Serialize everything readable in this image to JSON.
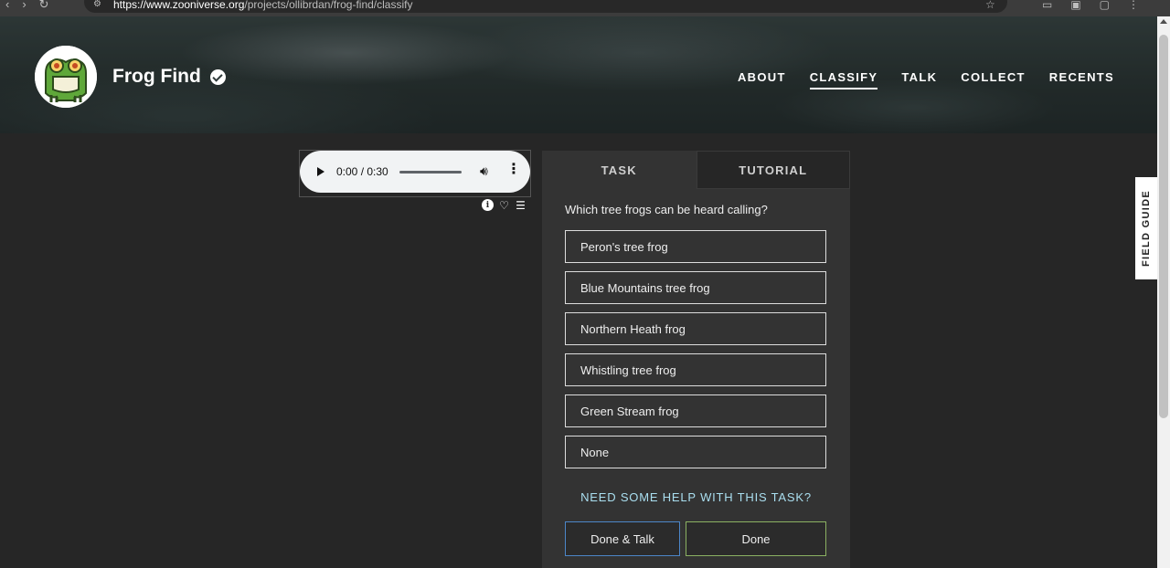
{
  "browser": {
    "url_host": "https://www.zooniverse.org",
    "url_path": "/projects/ollibrdan/frog-find/classify"
  },
  "header": {
    "title": "Frog Find",
    "nav": [
      {
        "label": "ABOUT",
        "active": false
      },
      {
        "label": "CLASSIFY",
        "active": true
      },
      {
        "label": "TALK",
        "active": false
      },
      {
        "label": "COLLECT",
        "active": false
      },
      {
        "label": "RECENTS",
        "active": false
      }
    ]
  },
  "audio": {
    "time": "0:00 / 0:30"
  },
  "task_panel": {
    "tabs": [
      {
        "label": "TASK",
        "active": true
      },
      {
        "label": "TUTORIAL",
        "active": false
      }
    ],
    "question": "Which tree frogs can be heard calling?",
    "answers": [
      "Peron's tree frog",
      "Blue Mountains tree frog",
      "Northern Heath frog",
      "Whistling tree frog",
      "Green Stream frog",
      "None"
    ],
    "help_label": "NEED SOME HELP WITH THIS TASK?",
    "done_talk_label": "Done & Talk",
    "done_label": "Done"
  },
  "field_guide": {
    "label": "FIELD GUIDE"
  },
  "colors": {
    "background": "#262626",
    "panel": "#333333",
    "help_link": "#aadff0",
    "done_talk_border": "#4c86c8",
    "done_border": "#8bb162",
    "frog_green": "#5fa83a"
  }
}
